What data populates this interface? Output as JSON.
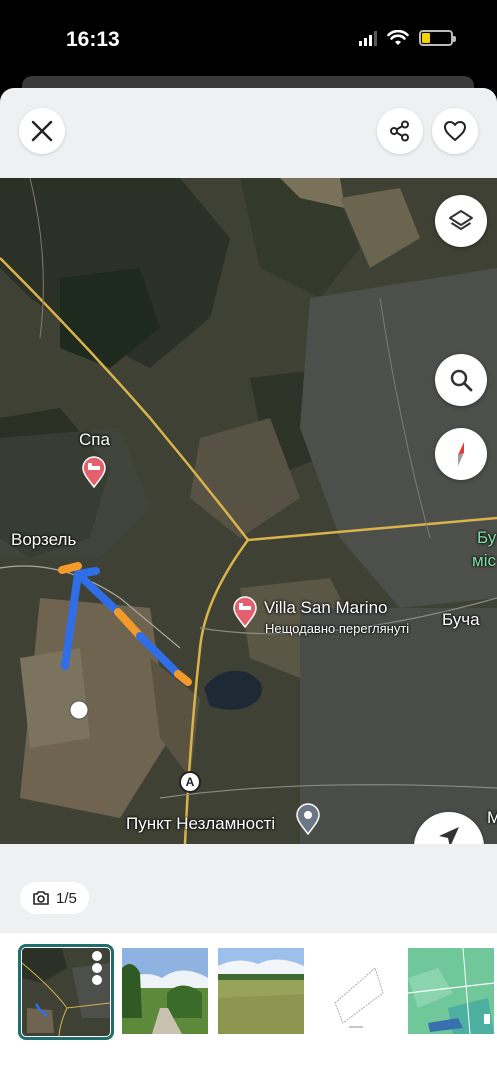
{
  "status_bar": {
    "time": "16:13",
    "battery_color": "#f5d100"
  },
  "top_bar": {
    "close_icon": "close-icon",
    "share_icon": "share-icon",
    "favorite_icon": "heart-icon"
  },
  "map": {
    "controls": [
      "layers-icon",
      "search-icon",
      "compass-icon",
      "navigate-icon"
    ],
    "places": {
      "spa": "Спа",
      "vorzel": "Ворзель",
      "villa_name": "Villa San Marino",
      "villa_sub": "Нещодавно переглянуті",
      "bucha": "Буча",
      "bucha_partial_1": "Бу",
      "bucha_partial_2": "міс",
      "punkt": "Пункт Незламності",
      "edge_partial": "М"
    },
    "route_marker_label": "A",
    "route_colors": [
      "#2f6ee6",
      "#f39a2b"
    ]
  },
  "gallery": {
    "counter": "1/5",
    "camera_icon": "camera-icon"
  },
  "thumbnails": [
    {
      "name": "map-screenshot-thumb"
    },
    {
      "name": "road-trees-photo-thumb"
    },
    {
      "name": "field-photo-thumb"
    },
    {
      "name": "plot-plan-thumb"
    },
    {
      "name": "satellite-plot-thumb"
    }
  ]
}
